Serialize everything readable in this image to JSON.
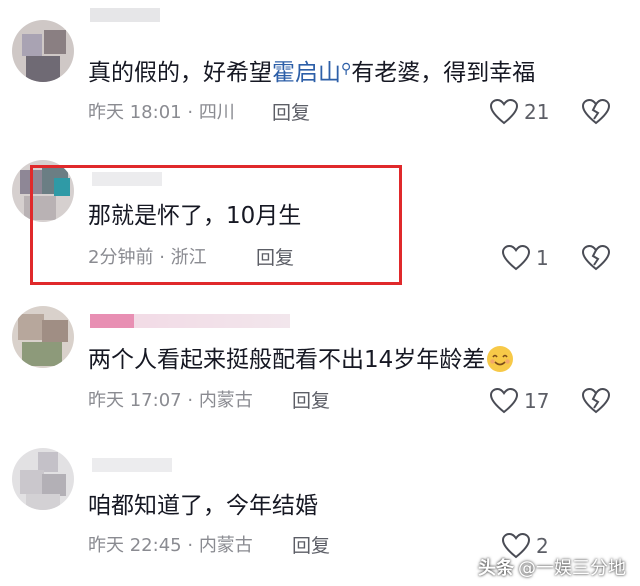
{
  "comments": [
    {
      "text_before": "真的假的，好希望",
      "keyword": "霍启山",
      "text_after": "有老婆，得到幸福",
      "time": "昨天 18:01",
      "location": "四川",
      "reply_label": "回复",
      "likes": "21"
    },
    {
      "text": "那就是怀了，10月生",
      "time": "2分钟前",
      "location": "浙江",
      "reply_label": "回复",
      "likes": "1"
    },
    {
      "text": "两个人看起来挺般配看不出14岁年龄差",
      "emoji": "smiling-face-emoji",
      "time": "昨天 17:07",
      "location": "内蒙古",
      "reply_label": "回复",
      "likes": "17"
    },
    {
      "text": "咱都知道了，今年结婚",
      "time": "昨天 22:45",
      "location": "内蒙古",
      "reply_label": "回复",
      "likes": "2"
    }
  ],
  "separator": "·",
  "highlight_color": "#e0292b",
  "keyword_color": "#2d5fa8",
  "icons": {
    "like": "heart-outline-icon",
    "dislike": "broken-heart-icon",
    "search": "search-icon"
  },
  "watermark": {
    "platform": "头条",
    "account": "@一娱三分地"
  }
}
